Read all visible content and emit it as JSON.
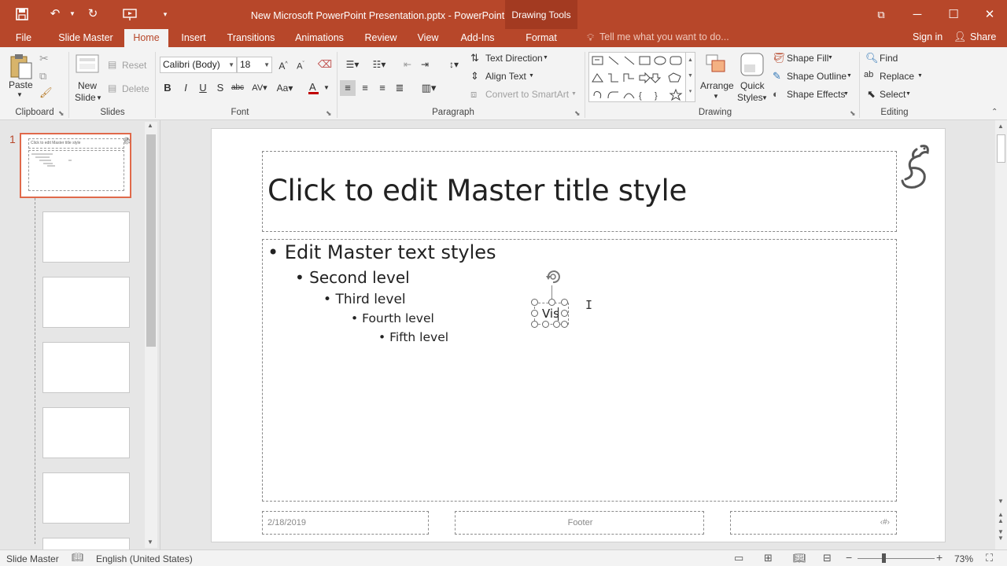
{
  "app": {
    "window_title": "New Microsoft PowerPoint Presentation.pptx - PowerPoint",
    "context_title": "Drawing Tools",
    "accent": "#b7472a"
  },
  "tabs": [
    "File",
    "Slide Master",
    "Home",
    "Insert",
    "Transitions",
    "Animations",
    "Review",
    "View",
    "Add-Ins",
    "Format"
  ],
  "active_tab": "Home",
  "tell_me": "Tell me what you want to do...",
  "sign_in": "Sign in",
  "share": "Share",
  "ribbon": {
    "clipboard": {
      "label": "Clipboard",
      "paste": "Paste"
    },
    "slides": {
      "label": "Slides",
      "new_slide_1": "New",
      "new_slide_2": "Slide",
      "reset": "Reset",
      "delete": "Delete"
    },
    "font": {
      "label": "Font",
      "font_name": "Calibri (Body)",
      "font_size": "18"
    },
    "paragraph": {
      "label": "Paragraph",
      "text_direction": "Text Direction",
      "align_text": "Align Text",
      "convert_smartart": "Convert to SmartArt"
    },
    "drawing": {
      "label": "Drawing",
      "arrange": "Arrange",
      "quick_styles_1": "Quick",
      "quick_styles_2": "Styles",
      "shape_fill": "Shape Fill",
      "shape_outline": "Shape Outline",
      "shape_effects": "Shape Effects"
    },
    "editing": {
      "label": "Editing",
      "find": "Find",
      "replace": "Replace",
      "select": "Select"
    }
  },
  "thumbnails": {
    "first_number": "1",
    "first_title": "Click to edit Master title style"
  },
  "slide": {
    "title": "Click to edit Master title style",
    "levels": [
      "Edit Master text styles",
      "Second level",
      "Third level",
      "Fourth level",
      "Fifth level"
    ],
    "textbox_text": "Vis",
    "date": "2/18/2019",
    "footer": "Footer",
    "page_number": "‹#›"
  },
  "status": {
    "view": "Slide Master",
    "language": "English (United States)",
    "zoom": "73%"
  }
}
